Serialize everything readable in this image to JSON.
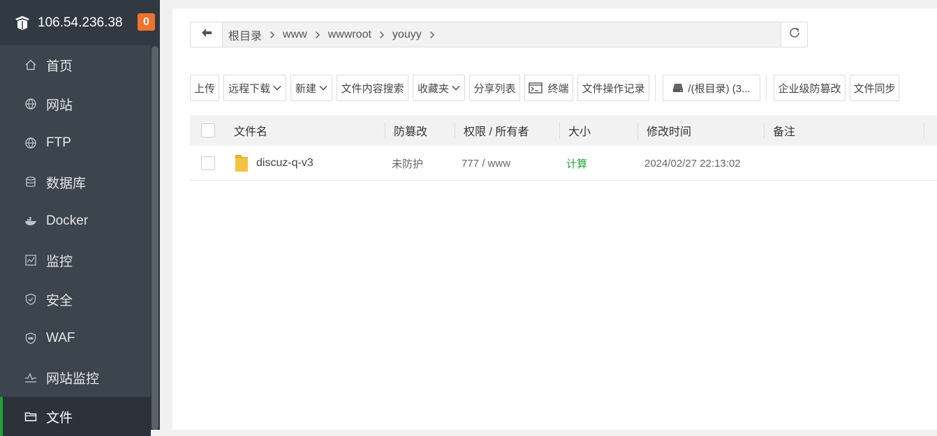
{
  "server": {
    "ip": "106.54.236.38",
    "badge": "0"
  },
  "nav": [
    {
      "label": "首页",
      "icon": "home-icon"
    },
    {
      "label": "网站",
      "icon": "globe-icon"
    },
    {
      "label": "FTP",
      "icon": "ftp-globe-icon"
    },
    {
      "label": "数据库",
      "icon": "database-icon"
    },
    {
      "label": "Docker",
      "icon": "docker-icon"
    },
    {
      "label": "监控",
      "icon": "monitor-icon"
    },
    {
      "label": "安全",
      "icon": "shield-icon"
    },
    {
      "label": "WAF",
      "icon": "waf-shield-icon"
    },
    {
      "label": "网站监控",
      "icon": "chart-line-icon"
    },
    {
      "label": "文件",
      "icon": "folder-icon",
      "active": true
    }
  ],
  "path": {
    "crumbs": [
      "根目录",
      "www",
      "wwwroot",
      "youyy"
    ]
  },
  "toolbar": {
    "upload": "上传",
    "remote_download": "远程下载",
    "new": "新建",
    "content_search": "文件内容搜索",
    "favorites": "收藏夹",
    "share_list": "分享列表",
    "terminal": "终端",
    "file_log": "文件操作记录",
    "disk": "/(根目录) (3...",
    "tamper_proof": "企业级防篡改",
    "file_sync": "文件同步"
  },
  "table": {
    "headers": {
      "name": "文件名",
      "tamper": "防篡改",
      "perm": "权限 / 所有者",
      "size": "大小",
      "mtime": "修改时间",
      "note": "备注"
    },
    "rows": [
      {
        "name": "discuz-q-v3",
        "tamper": "未防护",
        "perm": "777 / www",
        "size": "计算",
        "mtime": "2024/02/27 22:13:02",
        "note": ""
      }
    ]
  },
  "colors": {
    "accent": "#20a53a",
    "badge": "#f0722e",
    "sidebar": "#3c444d",
    "folder": "#f5c342"
  }
}
